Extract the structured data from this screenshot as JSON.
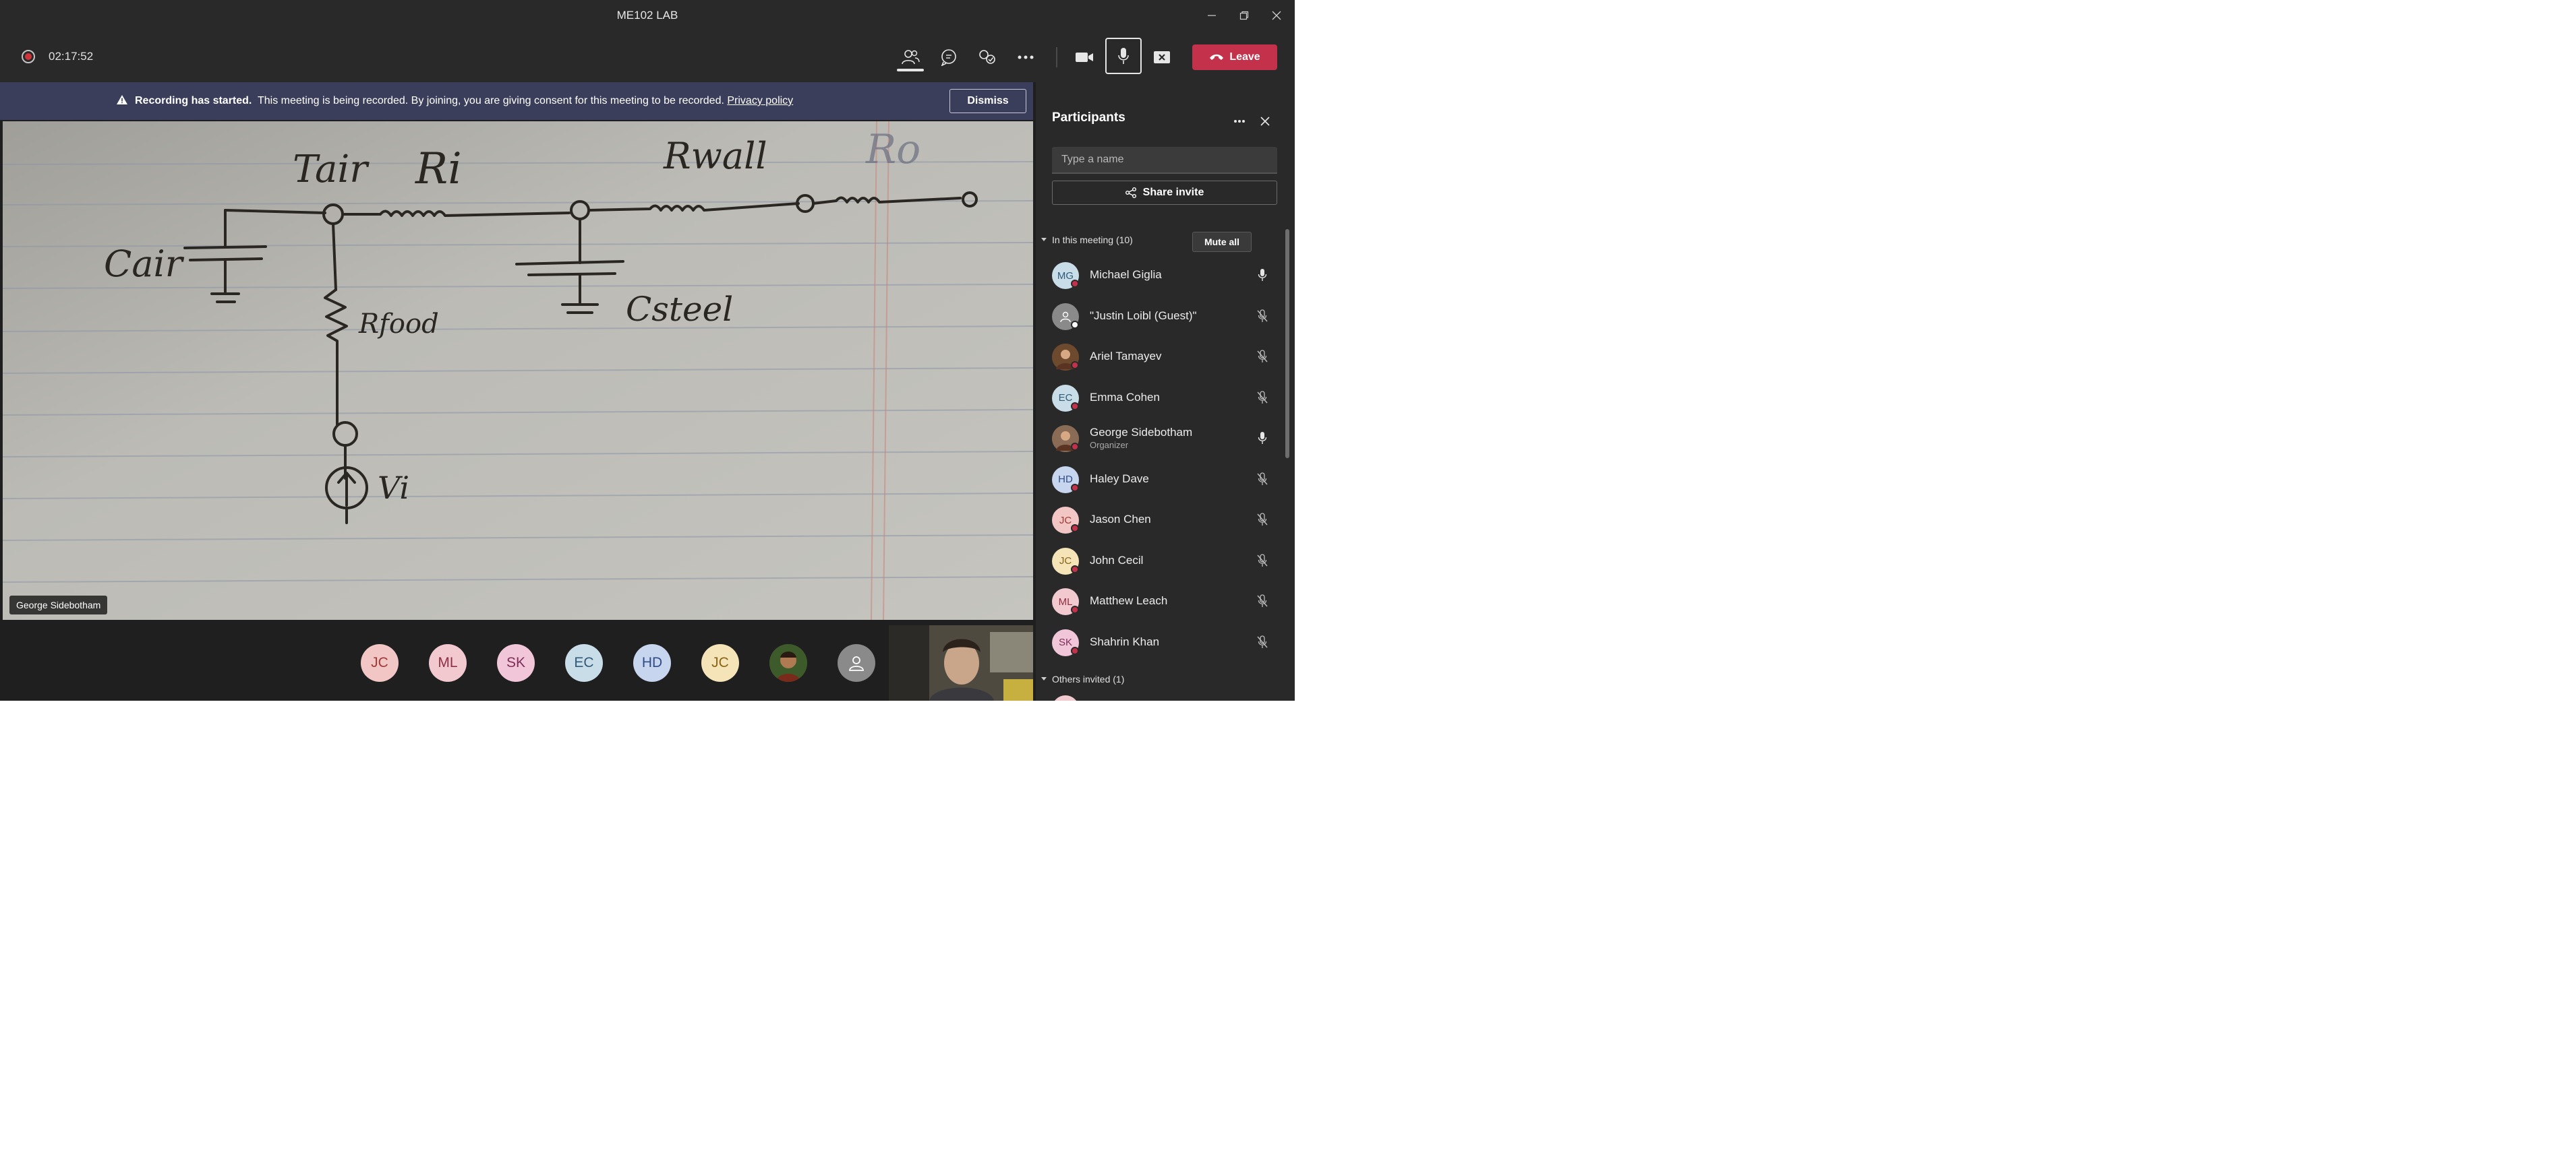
{
  "window": {
    "title": "ME102 LAB",
    "controls": [
      "minimize-icon",
      "restore-icon",
      "close-icon"
    ]
  },
  "toolbar": {
    "recording_time": "02:17:52",
    "icons": [
      "people-icon",
      "chat-icon",
      "raise-hand-icon",
      "more-icon",
      "camera-icon",
      "mic-icon",
      "share-screen-icon"
    ],
    "leave_label": "Leave",
    "leave_color": "#c4314b"
  },
  "banner": {
    "title": "Recording has started.",
    "message": "This meeting is being recorded. By joining, you are giving consent for this meeting to be recorded.",
    "link": "Privacy policy",
    "dismiss_label": "Dismiss"
  },
  "stage": {
    "speaker_name": "George Sidebotham",
    "sketch_labels": [
      "Tair",
      "Ri",
      "Rwall",
      "Ro",
      "Cair",
      "Rfood",
      "Csteel",
      "Vi"
    ]
  },
  "video_strip": {
    "avatars": [
      {
        "initials": "JC",
        "bg": "#f2c6c4",
        "fg": "#9e3a36"
      },
      {
        "initials": "ML",
        "bg": "#f3c9d0",
        "fg": "#8e2f44"
      },
      {
        "initials": "SK",
        "bg": "#f2c6d9",
        "fg": "#7f2e58"
      },
      {
        "initials": "EC",
        "bg": "#c9dde9",
        "fg": "#2f5b78"
      },
      {
        "initials": "HD",
        "bg": "#c7d5ee",
        "fg": "#2e4c86"
      },
      {
        "initials": "JC",
        "bg": "#f5e4b8",
        "fg": "#8a6416"
      }
    ]
  },
  "panel": {
    "title": "Participants",
    "search_placeholder": "Type a name",
    "share_label": "Share invite",
    "in_meeting_label": "In this meeting (10)",
    "mute_all_label": "Mute all",
    "others_label": "Others invited (1)",
    "participants": [
      {
        "name": "Michael Giglia",
        "initials": "MG",
        "avatar_bg": "#c9dde9",
        "avatar_fg": "#2f5b78",
        "role": "",
        "mic": "on",
        "status": "red"
      },
      {
        "name": "\"Justin Loibl (Guest)\"",
        "initials": "",
        "avatar_bg": "#8a8a8a",
        "avatar_fg": "#ffffff",
        "role": "",
        "mic": "off",
        "status": "white"
      },
      {
        "name": "Ariel Tamayev",
        "initials": "",
        "avatar_bg": "#6d4a2e",
        "avatar_fg": "#ffffff",
        "role": "",
        "mic": "off",
        "status": "red"
      },
      {
        "name": "Emma Cohen",
        "initials": "EC",
        "avatar_bg": "#c9dde9",
        "avatar_fg": "#2f5b78",
        "role": "",
        "mic": "off",
        "status": "red"
      },
      {
        "name": "George Sidebotham",
        "initials": "",
        "avatar_bg": "#8a6b55",
        "avatar_fg": "#ffffff",
        "role": "Organizer",
        "mic": "on",
        "status": "red"
      },
      {
        "name": "Haley Dave",
        "initials": "HD",
        "avatar_bg": "#c7d5ee",
        "avatar_fg": "#2e4c86",
        "role": "",
        "mic": "off",
        "status": "red"
      },
      {
        "name": "Jason Chen",
        "initials": "JC",
        "avatar_bg": "#f2c6c4",
        "avatar_fg": "#9e3a36",
        "role": "",
        "mic": "off",
        "status": "red"
      },
      {
        "name": "John Cecil",
        "initials": "JC",
        "avatar_bg": "#f5e4b8",
        "avatar_fg": "#8a6416",
        "role": "",
        "mic": "off",
        "status": "red"
      },
      {
        "name": "Matthew Leach",
        "initials": "ML",
        "avatar_bg": "#f3c9d0",
        "avatar_fg": "#8e2f44",
        "role": "",
        "mic": "off",
        "status": "red"
      },
      {
        "name": "Shahrin Khan",
        "initials": "SK",
        "avatar_bg": "#f2c6d9",
        "avatar_fg": "#7f2e58",
        "role": "",
        "mic": "off",
        "status": "red"
      }
    ]
  }
}
